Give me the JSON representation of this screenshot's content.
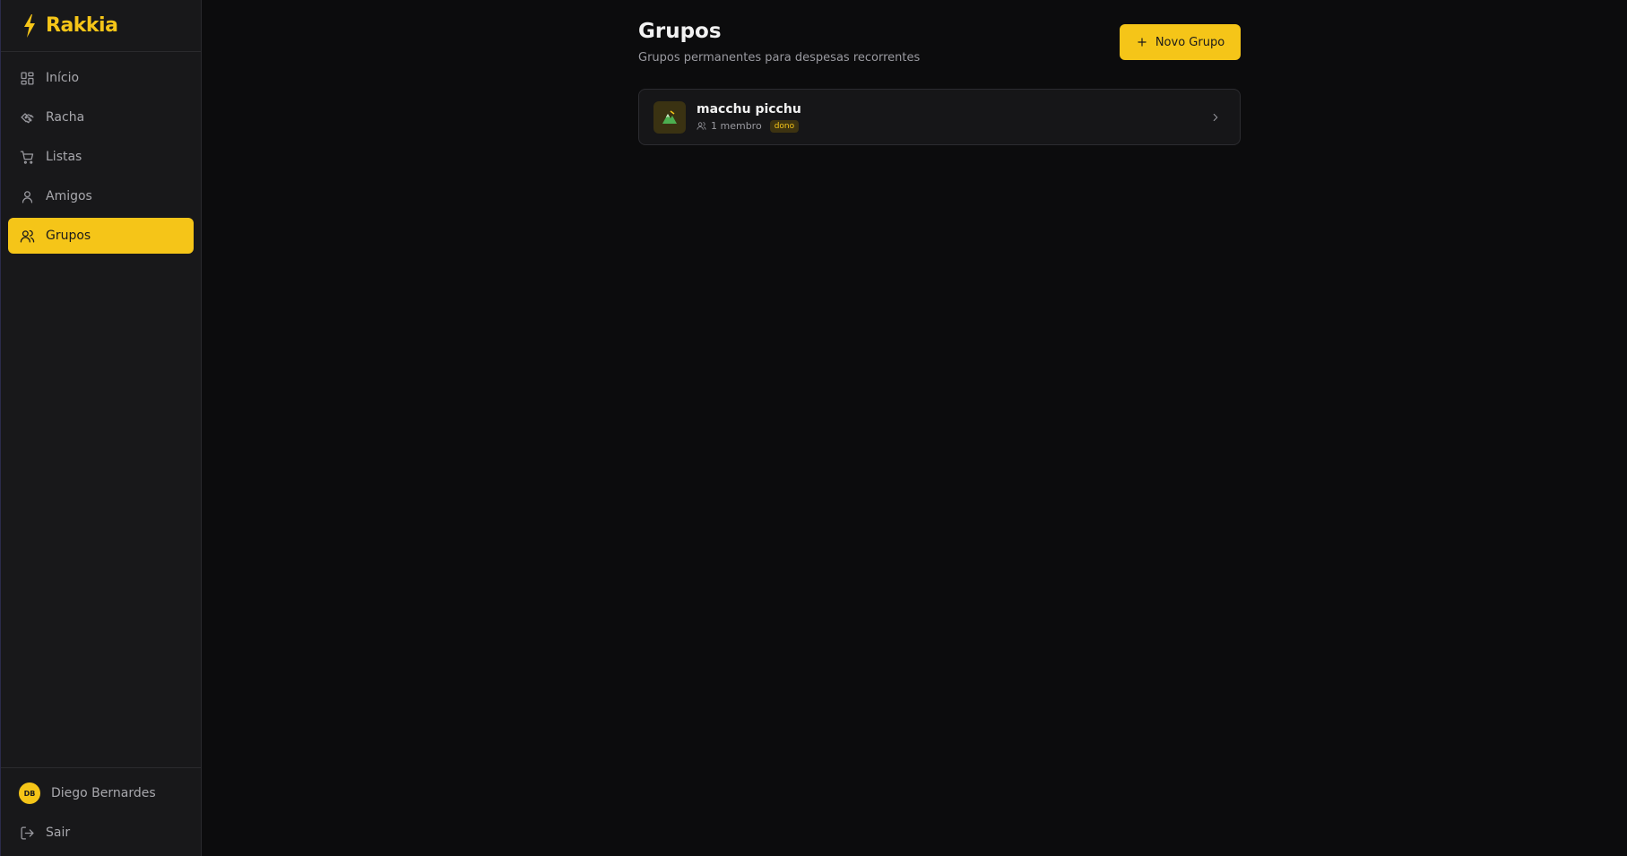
{
  "app": {
    "name": "Rakkia",
    "accent": "#f5c518"
  },
  "sidebar": {
    "items": [
      {
        "label": "Início",
        "icon": "dashboard-icon"
      },
      {
        "label": "Racha",
        "icon": "handshake-icon"
      },
      {
        "label": "Listas",
        "icon": "cart-icon"
      },
      {
        "label": "Amigos",
        "icon": "user-icon"
      },
      {
        "label": "Grupos",
        "icon": "users-icon",
        "active": true
      }
    ],
    "user": {
      "initials": "DB",
      "name": "Diego Bernardes"
    },
    "logout_label": "Sair"
  },
  "page": {
    "title": "Grupos",
    "subtitle": "Grupos permanentes para despesas recorrentes",
    "new_button_label": "Novo Grupo"
  },
  "groups": [
    {
      "name": "macchu picchu",
      "members": "1 membro",
      "role": "dono"
    }
  ]
}
